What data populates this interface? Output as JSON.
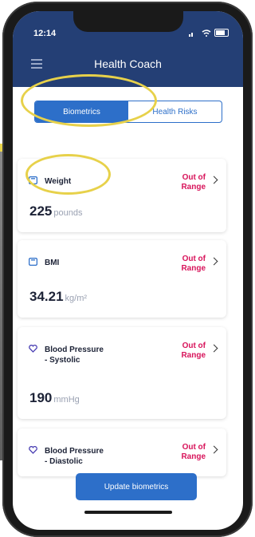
{
  "status_bar": {
    "time": "12:14"
  },
  "header": {
    "title": "Health Coach"
  },
  "tabs": [
    {
      "label": "Biometrics",
      "active": true
    },
    {
      "label": "Health Risks",
      "active": false
    }
  ],
  "cards": [
    {
      "label": "Weight",
      "status_line1": "Out of",
      "status_line2": "Range",
      "value": "225",
      "unit": "pounds",
      "icon": "scale-icon"
    },
    {
      "label": "BMI",
      "status_line1": "Out of",
      "status_line2": "Range",
      "value": "34.21",
      "unit": "kg/m²",
      "icon": "scale-icon"
    },
    {
      "label": "Blood Pressure - Systolic",
      "status_line1": "Out of",
      "status_line2": "Range",
      "value": "190",
      "unit": "mmHg",
      "icon": "heart-icon"
    },
    {
      "label": "Blood Pressure - Diastolic",
      "status_line1": "Out of",
      "status_line2": "Range",
      "icon": "heart-icon"
    }
  ],
  "update_button": {
    "label": "Update biometrics"
  },
  "colors": {
    "header": "#243f75",
    "accent": "#2d6fc9",
    "alert": "#d8145b",
    "highlight": "#e7d14a"
  }
}
